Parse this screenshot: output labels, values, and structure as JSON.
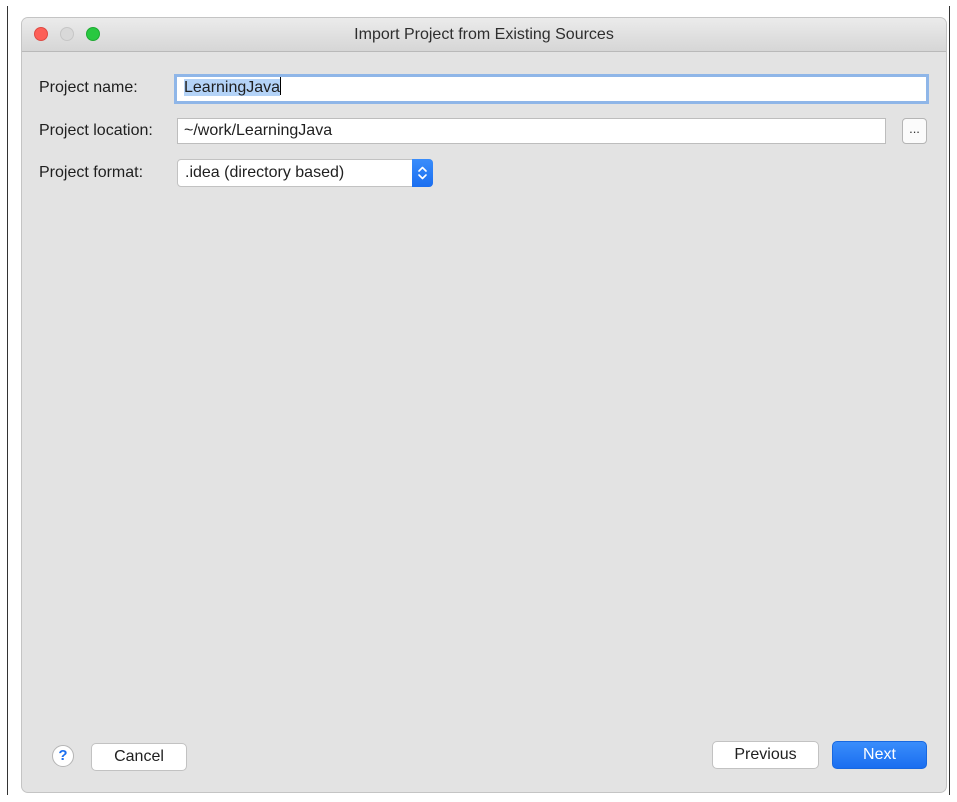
{
  "window": {
    "title": "Import Project from Existing Sources"
  },
  "form": {
    "project_name": {
      "label": "Project name:",
      "value": "LearningJava"
    },
    "project_location": {
      "label": "Project location:",
      "value": "~/work/LearningJava",
      "browse_label": "..."
    },
    "project_format": {
      "label": "Project format:",
      "selected": ".idea (directory based)"
    }
  },
  "footer": {
    "help_label": "?",
    "cancel_label": "Cancel",
    "previous_label": "Previous",
    "next_label": "Next"
  },
  "colors": {
    "accent": "#1a6ef0",
    "close": "#fd5f57",
    "minimize": "#d9d9d9",
    "maximize": "#28c840",
    "focus_ring": "#8fb6e8",
    "selection": "#b4d3f7"
  }
}
